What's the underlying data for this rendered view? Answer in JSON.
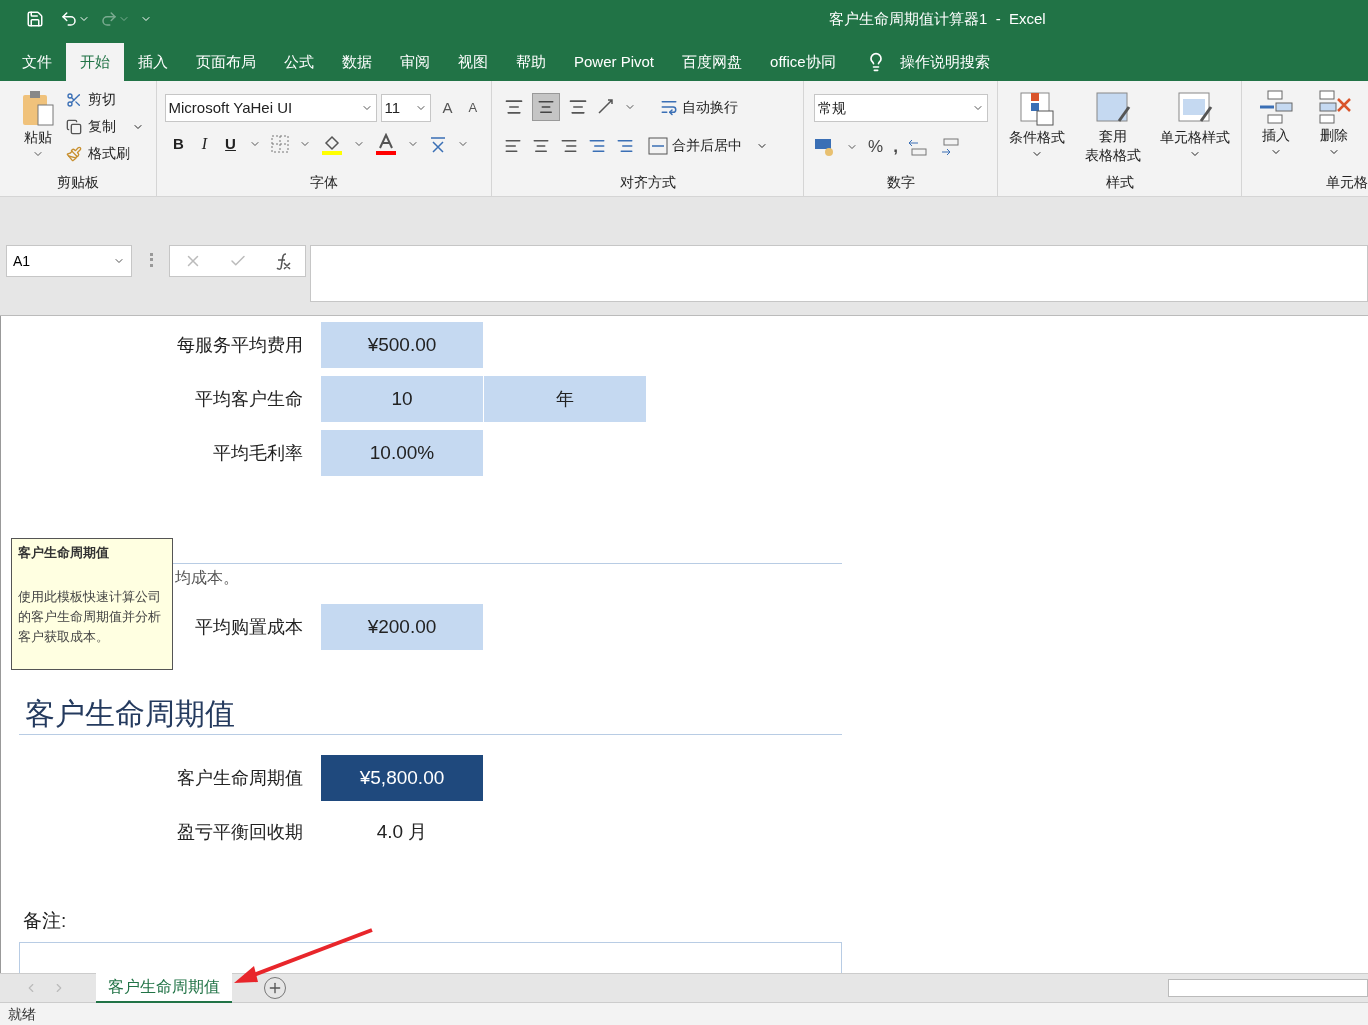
{
  "window": {
    "title": "客户生命周期值计算器1  -  Excel"
  },
  "menu_tabs": [
    {
      "label": "文件",
      "selected": false
    },
    {
      "label": "开始",
      "selected": true
    },
    {
      "label": "插入",
      "selected": false
    },
    {
      "label": "页面布局",
      "selected": false
    },
    {
      "label": "公式",
      "selected": false
    },
    {
      "label": "数据",
      "selected": false
    },
    {
      "label": "审阅",
      "selected": false
    },
    {
      "label": "视图",
      "selected": false
    },
    {
      "label": "帮助",
      "selected": false
    },
    {
      "label": "Power Pivot",
      "selected": false
    },
    {
      "label": "百度网盘",
      "selected": false
    },
    {
      "label": "office协同",
      "selected": false
    }
  ],
  "tell_me": "操作说明搜索",
  "ribbon": {
    "clipboard": {
      "paste": "粘贴",
      "cut": "剪切",
      "copy": "复制",
      "format_painter": "格式刷",
      "label": "剪贴板"
    },
    "font": {
      "font_name": "Microsoft YaHei UI",
      "font_size": "11",
      "bold": "B",
      "italic": "I",
      "underline": "U",
      "grow": "A",
      "shrink": "A",
      "label": "字体"
    },
    "alignment": {
      "wrap_text": "自动换行",
      "merge_center": "合并后居中",
      "label": "对齐方式"
    },
    "number": {
      "format": "常规",
      "percent": "%",
      "comma": ",",
      "label": "数字"
    },
    "styles": {
      "conditional": "条件格式",
      "table_line1": "套用",
      "table_line2": "表格格式",
      "cell_styles": "单元格样式",
      "label": "样式"
    },
    "cells": {
      "insert": "插入",
      "delete": "删除",
      "label": "单元格"
    }
  },
  "formula_bar": {
    "name_box": "A1"
  },
  "sheet": {
    "rows_top": [
      {
        "label": "每服务平均费用",
        "value": "¥500.00"
      },
      {
        "label": "平均客户生命",
        "value": "10",
        "unit": "年"
      },
      {
        "label": "平均毛利率",
        "value": "10.00%"
      }
    ],
    "section_acquisition": {
      "subtitle": "均成本。",
      "rows": [
        {
          "label": "平均购置成本",
          "value": "¥200.00"
        }
      ]
    },
    "section_clv": {
      "heading": "客户生命周期值",
      "rows": [
        {
          "label": "客户生命周期值",
          "value": "¥5,800.00",
          "kind": "result"
        },
        {
          "label": "盈亏平衡回收期",
          "value": "4.0 月",
          "kind": "plain"
        }
      ]
    },
    "notes_label": "备注:",
    "tooltip": {
      "title": "客户生命周期值",
      "body": "使用此模板快速计算公司的客户生命周期值并分析客户获取成本。"
    }
  },
  "sheet_tabs": [
    {
      "label": "客户生命周期值",
      "selected": true
    }
  ],
  "status_bar": {
    "text": "就绪"
  }
}
